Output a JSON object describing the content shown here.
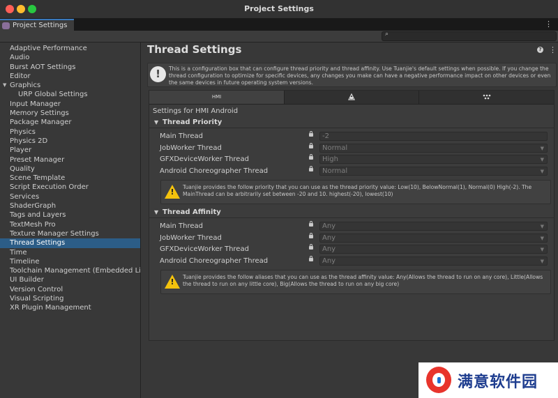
{
  "window": {
    "title": "Project Settings"
  },
  "tab": {
    "label": "Project Settings",
    "menu_glyph": "⋮"
  },
  "search": {
    "placeholder": "",
    "icon": "search-icon"
  },
  "sidebar": {
    "items": [
      {
        "label": "Adaptive Performance"
      },
      {
        "label": "Audio"
      },
      {
        "label": "Burst AOT Settings"
      },
      {
        "label": "Editor"
      },
      {
        "label": "Graphics",
        "expanded": true
      },
      {
        "label": "URP Global Settings",
        "sub": true
      },
      {
        "label": "Input Manager"
      },
      {
        "label": "Memory Settings"
      },
      {
        "label": "Package Manager"
      },
      {
        "label": "Physics"
      },
      {
        "label": "Physics 2D"
      },
      {
        "label": "Player"
      },
      {
        "label": "Preset Manager"
      },
      {
        "label": "Quality"
      },
      {
        "label": "Scene Template"
      },
      {
        "label": "Script Execution Order"
      },
      {
        "label": "Services"
      },
      {
        "label": "ShaderGraph"
      },
      {
        "label": "Tags and Layers"
      },
      {
        "label": "TextMesh Pro"
      },
      {
        "label": "Texture Manager Settings"
      },
      {
        "label": "Thread Settings",
        "selected": true
      },
      {
        "label": "Time"
      },
      {
        "label": "Timeline"
      },
      {
        "label": "Toolchain Management (Embedded Linux)"
      },
      {
        "label": "UI Builder"
      },
      {
        "label": "Version Control"
      },
      {
        "label": "Visual Scripting"
      },
      {
        "label": "XR Plugin Management"
      }
    ]
  },
  "main": {
    "title": "Thread Settings",
    "help_glyph": "?",
    "menu_glyph": "⋮",
    "info_text": "This is a configuration box that can configure thread priority and thread affinity. Use Tuanjie's default settings when possible. If you change the thread configuration to optimize for specific devices, any changes you make can have a negative performance impact on other devices or even the same devices in future operating system versions.",
    "platform_tabs": [
      {
        "label": "HMI",
        "icon": "hmi-tab"
      },
      {
        "label": "",
        "icon": "android-icon"
      },
      {
        "label": "",
        "icon": "platform-grid-icon"
      }
    ],
    "settings_for": "Settings for HMI Android",
    "priority": {
      "title": "Thread Priority",
      "rows": [
        {
          "label": "Main Thread",
          "value": "-2",
          "dropdown": false
        },
        {
          "label": "JobWorker Thread",
          "value": "Normal",
          "dropdown": true
        },
        {
          "label": "GFXDeviceWorker Thread",
          "value": "High",
          "dropdown": true
        },
        {
          "label": "Android Choreographer Thread",
          "value": "Normal",
          "dropdown": true
        }
      ],
      "warning": "Tuanjie provides the follow priority that you can use as the thread priority value: Low(10), BelowNormal(1), Normal(0) High(-2). The MainThread can be arbitrarily set between -20 and 10. highest(-20), lowest(10)"
    },
    "affinity": {
      "title": "Thread Affinity",
      "rows": [
        {
          "label": "Main Thread",
          "value": "Any",
          "dropdown": true
        },
        {
          "label": "JobWorker Thread",
          "value": "Any",
          "dropdown": true
        },
        {
          "label": "GFXDeviceWorker Thread",
          "value": "Any",
          "dropdown": true
        },
        {
          "label": "Android Choreographer Thread",
          "value": "Any",
          "dropdown": true
        }
      ],
      "warning": "Tuanjie provides the follow aliases that you can use as the thread affinity value: Any(Allows the thread to run on any core), Little(Allows the thread to run on any little core), Big(Allows the thread to run on any big core)"
    }
  },
  "watermark": {
    "text": "满意软件园"
  },
  "colors": {
    "selection": "#2c5d87",
    "accent": "#3a79bb",
    "warning": "#f4c20d"
  }
}
